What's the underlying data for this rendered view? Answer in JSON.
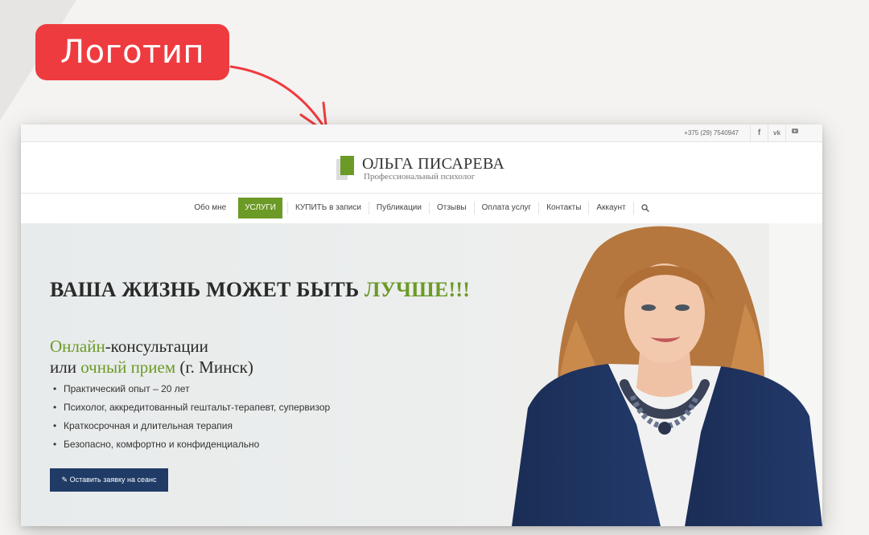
{
  "annotation": {
    "label": "Логотип",
    "color": "#ee3b3f"
  },
  "site": {
    "topbar": {
      "phone": "+375 (29) 7540947",
      "social": [
        "f",
        "vk",
        "yt"
      ]
    },
    "logo": {
      "name": "ОЛЬГА ПИСАРЕВА",
      "tagline": "Профессиональный психолог",
      "accent": "#6c9a26"
    },
    "nav": {
      "items": [
        {
          "label": "Обо мне"
        },
        {
          "label": "УСЛУГИ",
          "active": true
        },
        {
          "label": "КУПИТЬ в записи"
        },
        {
          "label": "Публикации"
        },
        {
          "label": "Отзывы"
        },
        {
          "label": "Оплата услуг"
        },
        {
          "label": "Контакты"
        },
        {
          "label": "Аккаунт"
        }
      ],
      "search_icon": "search-icon"
    },
    "hero": {
      "headline_main": "ВАША ЖИЗНЬ МОЖЕТ БЫТЬ",
      "headline_accent": "ЛУЧШЕ!!!",
      "sub_line1_accent": "Онлайн",
      "sub_line1_rest": "-консультации",
      "sub_line2_pre": "или",
      "sub_line2_accent": "очный прием",
      "sub_line2_post": "(г. Минск)",
      "bullets": [
        "Практический опыт – 20 лет",
        "Психолог, аккредитованный гештальт-терапевт, супервизор",
        "Краткосрочная и длительная терапия",
        "Безопасно, комфортно и конфиденциально"
      ],
      "cta_label": "Оставить заявку на сеанс",
      "cta_color": "#1f3b66"
    }
  }
}
